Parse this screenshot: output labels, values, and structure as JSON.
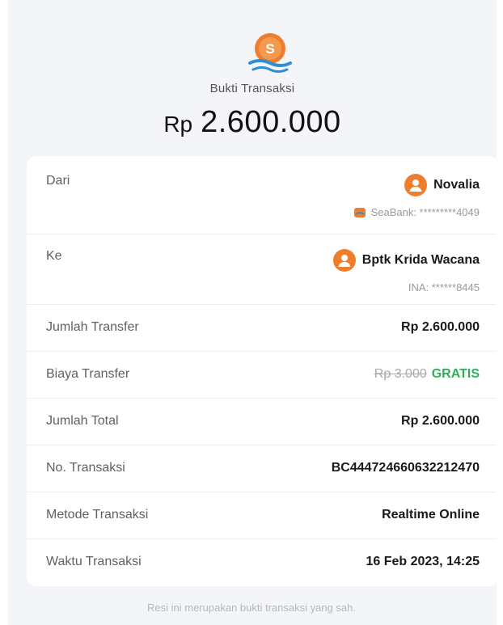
{
  "header": {
    "title": "Bukti Transaksi",
    "currency": "Rp",
    "amount": "2.600.000",
    "logo_letter": "S"
  },
  "from": {
    "label": "Dari",
    "name": "Novalia",
    "account": "SeaBank: *********4049"
  },
  "to": {
    "label": "Ke",
    "name": "Bptk Krida Wacana",
    "account": "INA: ******8445"
  },
  "details": [
    {
      "label": "Jumlah Transfer",
      "value": "Rp 2.600.000"
    },
    {
      "label": "Biaya Transfer",
      "old_value": "Rp 3.000",
      "value": "GRATIS"
    },
    {
      "label": "Jumlah Total",
      "value": "Rp 2.600.000"
    },
    {
      "label": "No. Transaksi",
      "value": "BC444724660632212470"
    },
    {
      "label": "Metode Transaksi",
      "value": "Realtime Online"
    },
    {
      "label": "Waktu Transaksi",
      "value": "16 Feb 2023, 14:25"
    }
  ],
  "footer": {
    "note": "Resi ini merupakan bukti transaksi yang sah."
  },
  "colors": {
    "brand_orange": "#ef7d2e",
    "free_green": "#2db055",
    "background": "#f4f5f8"
  }
}
